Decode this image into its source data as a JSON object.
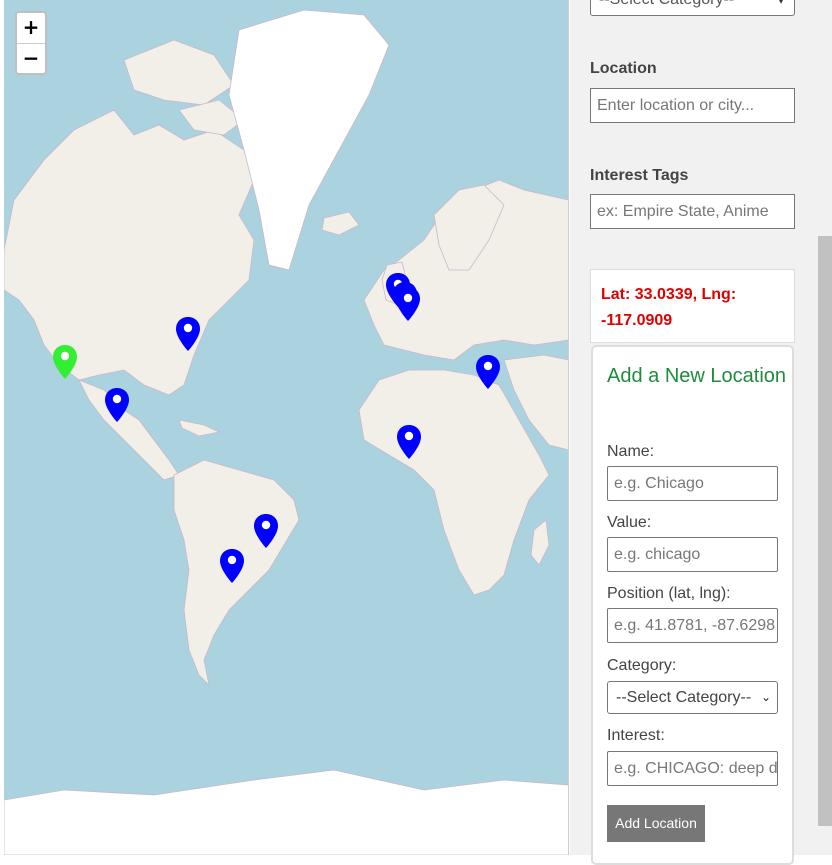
{
  "map": {
    "zoom_in": "+",
    "zoom_out": "−",
    "colors": {
      "water": "#aad3df",
      "land": "#f2efe9",
      "ice": "#ffffff",
      "marker": "#0000ff",
      "marker_selected": "#33ee33"
    },
    "markers": [
      {
        "label": "Los Angeles",
        "selected": true
      },
      {
        "label": "Toronto"
      },
      {
        "label": "Mexico"
      },
      {
        "label": "London"
      },
      {
        "label": "Netherlands"
      },
      {
        "label": "Amsterdam"
      },
      {
        "label": "Cyprus"
      },
      {
        "label": "Nigeria"
      },
      {
        "label": "Brasilia"
      },
      {
        "label": "Paraguay"
      }
    ]
  },
  "sidebar": {
    "category_select_top": "--Select Category--",
    "location_label": "Location",
    "location_placeholder": "Enter location or city...",
    "interest_tags_label": "Interest Tags",
    "interest_tags_placeholder": "ex: Empire State, Anime",
    "coords_text": "Lat: 33.0339, Lng: -117.0909"
  },
  "add_form": {
    "title": "Add a New Location",
    "name_label": "Name:",
    "name_placeholder": "e.g. Chicago",
    "value_label": "Value:",
    "value_placeholder": "e.g. chicago",
    "position_label": "Position (lat, lng):",
    "position_placeholder": "e.g. 41.8781, -87.6298",
    "category_label": "Category:",
    "category_selected": "--Select Category--",
    "interest_label": "Interest:",
    "interest_placeholder": "e.g. CHICAGO: deep dish pizza",
    "submit_label": "Add Location"
  }
}
